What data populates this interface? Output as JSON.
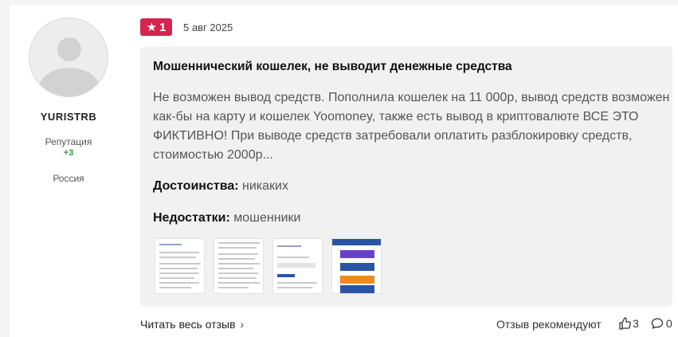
{
  "user": {
    "name": "YURISTRB",
    "reputation_label": "Репутация",
    "reputation_value": "+3",
    "country": "Россия"
  },
  "review": {
    "rating": "1",
    "date": "5 авг 2025",
    "title": "Мошеннический кошелек, не выводит денежные средства",
    "text": "Не возможен вывод средств. Пополнила кошелек на 11 000р, вывод средств возможен как-бы на карту и кошелек Yoomoney, также есть вывод в криптовалюте ВСЕ ЭТО ФИКТИВНО! При выводе средств затребовали оплатить разблокировку средств, стоимостью 2000р...",
    "pros_label": "Достоинства:",
    "pros_value": "никаких",
    "cons_label": "Недостатки:",
    "cons_value": "мошенники"
  },
  "footer": {
    "read_more": "Читать весь отзыв",
    "recommend": "Отзыв рекомендуют",
    "likes": "3",
    "comments": "0"
  },
  "colors": {
    "rating_badge": "#d6244e",
    "reputation": "#2a9a3a",
    "thumb_blue": "#2a55a5",
    "thumb_purple": "#6a3fd0",
    "thumb_orange": "#f08a1c"
  }
}
